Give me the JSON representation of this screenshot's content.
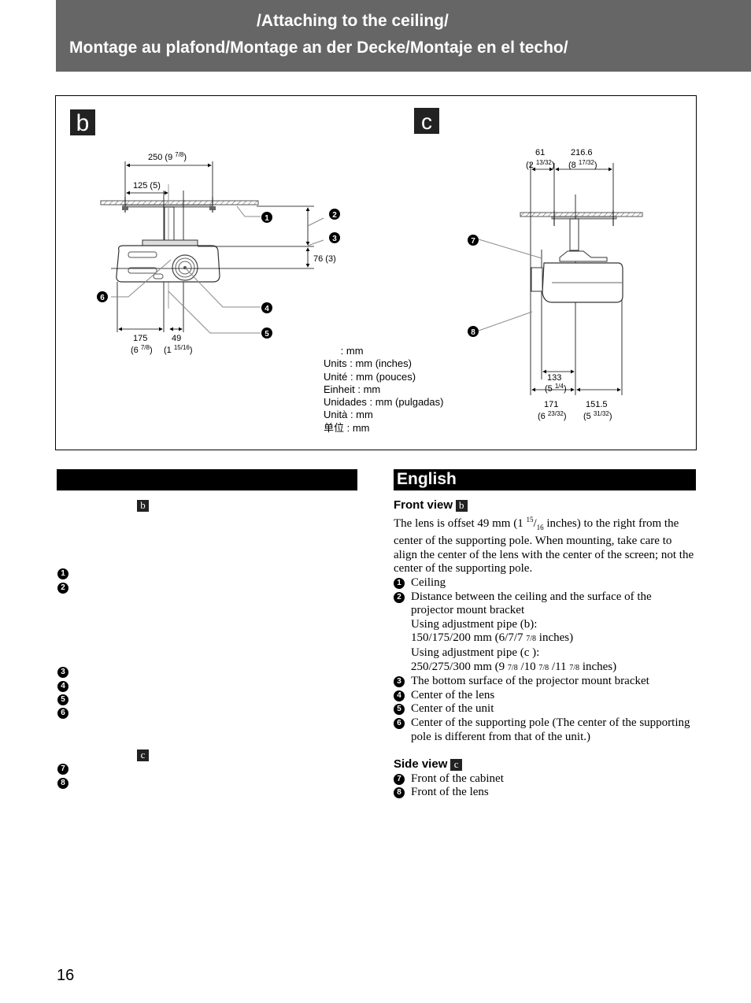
{
  "header": {
    "line1": "/Attaching to the ceiling/",
    "line2": "Montage au plafond/Montage an der Decke/Montaje en el techo/"
  },
  "figure": {
    "view_b": {
      "label": "b",
      "dims": {
        "d250": "250 (9 ",
        "d250_frac": "7/8",
        "d250_close": ")",
        "d125": "125 (5)",
        "d76": "76 (3)",
        "d175": "175",
        "d175_in": "(6 ",
        "d175_frac": "7/8",
        "d49": "49",
        "d49_in": "(1 ",
        "d49_frac": "15/16"
      },
      "callouts": [
        "1",
        "2",
        "3",
        "4",
        "5",
        "6"
      ]
    },
    "view_c": {
      "label": "c",
      "dims": {
        "d61": "61",
        "d61_in": "(2 ",
        "d61_frac": "13/32",
        "d216": "216.6",
        "d216_in": "(8 ",
        "d216_frac": "17/32",
        "d133": "133",
        "d133_in": "(5 ",
        "d133_frac": "1/4",
        "d171": "171",
        "d171_in": "(6 ",
        "d171_frac": "23/32",
        "d151": "151.5",
        "d151_in": "(5 ",
        "d151_frac": "31/32"
      },
      "callouts": [
        "7",
        "8"
      ]
    },
    "units": [
      "      : mm",
      "Units : mm (inches)",
      "Unité : mm (pouces)",
      "Einheit : mm",
      "Unidades : mm (pulgadas)",
      "Unità : mm",
      "单位 : mm"
    ]
  },
  "left_column": {
    "tag_b": "b",
    "tag_c": "c",
    "numbers": [
      "1",
      "2",
      "3",
      "4",
      "5",
      "6",
      "7",
      "8"
    ]
  },
  "english": {
    "section_title": "English",
    "front_view_heading": "Front view",
    "front_view_tag": "b",
    "front_view_text_a": "The lens is offset 49 mm (1 ",
    "front_view_frac_num": "15",
    "front_view_frac_den": "16",
    "front_view_text_b": " inches) to the right from the center of the supporting pole. When mounting, take care to align the center of the lens with the center of the screen; not the center of the supporting pole.",
    "items": [
      {
        "num": "1",
        "text": "Ceiling"
      },
      {
        "num": "2",
        "text": "Distance between the ceiling and the surface of the projector mount bracket"
      },
      {
        "num": "3",
        "text": "The bottom surface of the projector mount  bracket"
      },
      {
        "num": "4",
        "text": "Center of the lens"
      },
      {
        "num": "5",
        "text": "Center of the unit"
      },
      {
        "num": "6",
        "text": "Center of the supporting pole (The center of the supporting pole is different from that of the unit.)"
      }
    ],
    "pipe_b_label": "Using adjustment pipe (b):",
    "pipe_b_values": "150/175/200 mm (6/7/7 ",
    "pipe_b_frac": "7/8",
    "pipe_b_tail": " inches)",
    "pipe_c_label": "Using adjustment pipe (c ):",
    "pipe_c_values_a": "250/275/300 mm (9 ",
    "pipe_c_values_b": " /10 ",
    "pipe_c_values_c": " /11 ",
    "pipe_c_frac": "7/8",
    "pipe_c_tail": " inches)",
    "side_view_heading": "Side view",
    "side_view_tag": "c",
    "side_items": [
      {
        "num": "7",
        "text": "Front of the cabinet"
      },
      {
        "num": "8",
        "text": "Front of the lens"
      }
    ]
  },
  "page_number": "16"
}
